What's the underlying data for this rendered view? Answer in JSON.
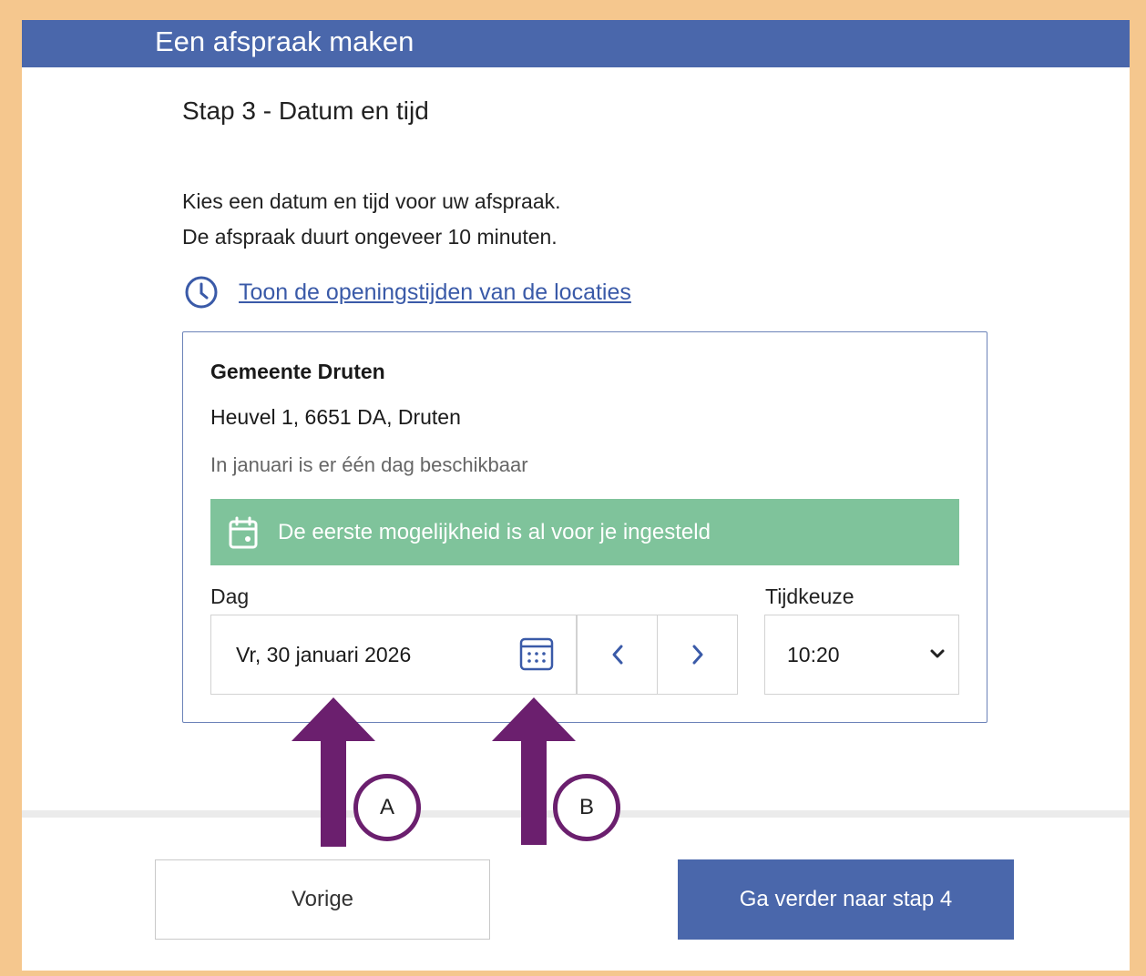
{
  "header": {
    "title": "Een afspraak maken"
  },
  "step": {
    "title": "Stap 3 - Datum en tijd"
  },
  "intro": {
    "line1": "Kies een datum en tijd voor uw afspraak.",
    "line2": "De afspraak duurt ongeveer 10 minuten."
  },
  "hours_link": {
    "label": "Toon de openingstijden van de locaties",
    "icon": "clock-icon"
  },
  "location": {
    "name": "Gemeente Druten",
    "address": "Heuvel 1, 6651 DA, Druten",
    "availability": "In januari is er één dag beschikbaar"
  },
  "notice": {
    "text": "De eerste mogelijkheid is al voor je ingesteld",
    "color": "#7fc39b",
    "icon": "calendar-icon"
  },
  "day": {
    "label": "Dag",
    "value": "Vr, 30 januari 2026"
  },
  "time": {
    "label": "Tijdkeuze",
    "value": "10:20"
  },
  "footer": {
    "prev_label": "Vorige",
    "next_label": "Ga verder naar stap 4"
  },
  "annotations": {
    "a": "A",
    "b": "B",
    "color": "#6b1f6e"
  },
  "colors": {
    "brand": "#4a67ab",
    "link": "#3a5aa8",
    "border": "#f5c78e"
  }
}
